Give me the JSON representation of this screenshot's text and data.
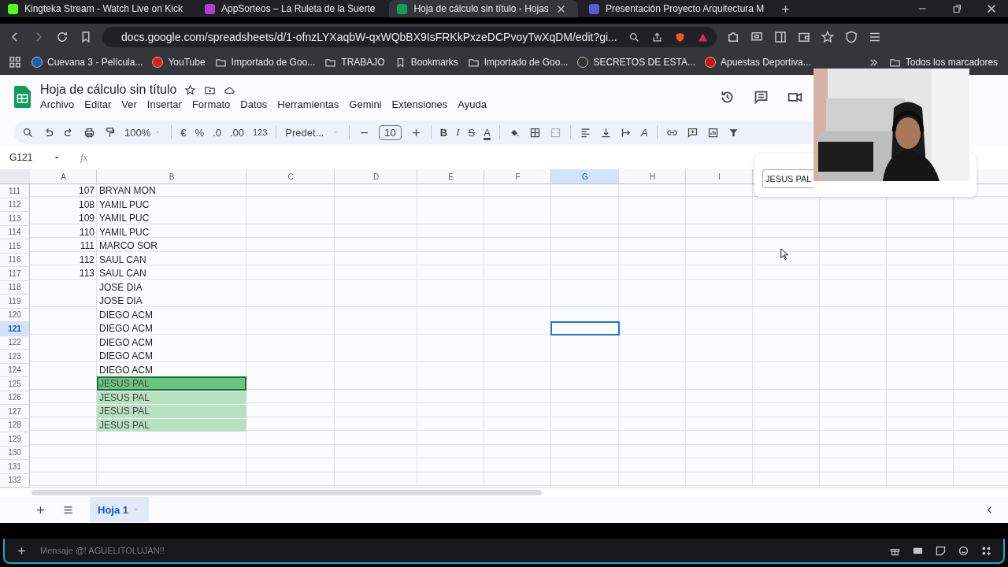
{
  "browser_tabs": [
    {
      "title": "Kingteka Stream - Watch Live on Kick",
      "color": "#53fc18",
      "selected": false
    },
    {
      "title": "AppSorteos – La Ruleta de la Suerte",
      "color": "#b03fd0",
      "selected": false
    },
    {
      "title": "Hoja de cálculo sin título - Hojas",
      "color": "#0f9d58",
      "selected": true
    },
    {
      "title": "Presentación Proyecto Arquitectura M",
      "color": "#5b5bd6",
      "selected": false
    }
  ],
  "address_bar": {
    "url": "docs.google.com/spreadsheets/d/1-ofnzLYXaqbW-qxWQbBX9IsFRKkPxzeDCPvoyTwXqDM/edit?gi..."
  },
  "bookmarks": [
    {
      "label": "Cuevana 3 - Película...",
      "kind": "site",
      "color": "#1a5fb4"
    },
    {
      "label": "YouTube",
      "kind": "site",
      "color": "#e0201c"
    },
    {
      "label": "Importado de Goo...",
      "kind": "folder"
    },
    {
      "label": "TRABAJO",
      "kind": "folder"
    },
    {
      "label": "Bookmarks",
      "kind": "page"
    },
    {
      "label": "Importado de Goo...",
      "kind": "folder"
    },
    {
      "label": "SECRETOS DE ESTA...",
      "kind": "site",
      "color": "#333333"
    },
    {
      "label": "Apuestas Deportiva...",
      "kind": "site",
      "color": "#d01010"
    }
  ],
  "all_bookmarks": "Todos los marcadores",
  "document": {
    "title": "Hoja de cálculo sin título"
  },
  "menu": [
    "Archivo",
    "Editar",
    "Ver",
    "Insertar",
    "Formato",
    "Datos",
    "Herramientas",
    "Gemini",
    "Extensiones",
    "Ayuda"
  ],
  "toolbar": {
    "zoom": "100%",
    "currency": "€",
    "percent": "%",
    "decrease_decimals": ".0",
    "increase_decimals": ".00",
    "number_format": "123",
    "font": "Predet...",
    "font_size": "10",
    "bold": "B",
    "italic": "I",
    "strikethrough": "S",
    "text_color": "A",
    "text_rotation": "A"
  },
  "formula_bar": {
    "name_box": "G121",
    "fx": "fx"
  },
  "columns": [
    {
      "label": "A",
      "selected": false
    },
    {
      "label": "B",
      "selected": false
    },
    {
      "label": "C",
      "selected": false
    },
    {
      "label": "D",
      "selected": false
    },
    {
      "label": "E",
      "selected": false
    },
    {
      "label": "F",
      "selected": false
    },
    {
      "label": "G",
      "selected": true
    },
    {
      "label": "H",
      "selected": false
    },
    {
      "label": "I",
      "selected": false
    }
  ],
  "rows": [
    {
      "number": "111",
      "a": "107",
      "b": "BRYAN MON",
      "selected": false,
      "match": false,
      "current_match": false
    },
    {
      "number": "112",
      "a": "108",
      "b": "YAMIL PUC",
      "selected": false,
      "match": false,
      "current_match": false
    },
    {
      "number": "113",
      "a": "109",
      "b": "YAMIL PUC",
      "selected": false,
      "match": false,
      "current_match": false
    },
    {
      "number": "114",
      "a": "110",
      "b": "YAMIL PUC",
      "selected": false,
      "match": false,
      "current_match": false
    },
    {
      "number": "115",
      "a": "111",
      "b": "MARCO SOR",
      "selected": false,
      "match": false,
      "current_match": false
    },
    {
      "number": "116",
      "a": "112",
      "b": "SAUL CAN",
      "selected": false,
      "match": false,
      "current_match": false
    },
    {
      "number": "117",
      "a": "113",
      "b": "SAUL CAN",
      "selected": false,
      "match": false,
      "current_match": false
    },
    {
      "number": "118",
      "b": "JOSE DIA",
      "selected": false,
      "match": false,
      "current_match": false
    },
    {
      "number": "119",
      "b": "JOSE DIA",
      "selected": false,
      "match": false,
      "current_match": false
    },
    {
      "number": "120",
      "b": "DIEGO ACM",
      "selected": false,
      "match": false,
      "current_match": false
    },
    {
      "number": "121",
      "b": "DIEGO ACM",
      "selected": true,
      "match": false,
      "current_match": false
    },
    {
      "number": "122",
      "b": "DIEGO ACM",
      "selected": false,
      "match": false,
      "current_match": false
    },
    {
      "number": "123",
      "b": "DIEGO ACM",
      "selected": false,
      "match": false,
      "current_match": false
    },
    {
      "number": "124",
      "b": "DIEGO ACM",
      "selected": false,
      "match": false,
      "current_match": false
    },
    {
      "number": "125",
      "b": "JESUS PAL",
      "selected": false,
      "match": true,
      "current_match": true
    },
    {
      "number": "126",
      "b": "JESUS PAL",
      "selected": false,
      "match": true,
      "current_match": false
    },
    {
      "number": "127",
      "b": "JESUS PAL",
      "selected": false,
      "match": true,
      "current_match": false
    },
    {
      "number": "128",
      "b": "JESUS PAL",
      "selected": false,
      "match": true,
      "current_match": false
    },
    {
      "number": "129",
      "selected": false,
      "match": false,
      "current_match": false
    },
    {
      "number": "130",
      "selected": false,
      "match": false,
      "current_match": false
    },
    {
      "number": "131",
      "selected": false,
      "match": false,
      "current_match": false
    },
    {
      "number": "132",
      "selected": false,
      "match": false,
      "current_match": false
    }
  ],
  "find_panel": {
    "value": "JESUS PAL"
  },
  "sheet_tabs": [
    {
      "label": "Hoja 1",
      "selected": true
    }
  ],
  "chat": {
    "placeholder": "Mensaje @! AGUELITOLUJAN!!"
  }
}
